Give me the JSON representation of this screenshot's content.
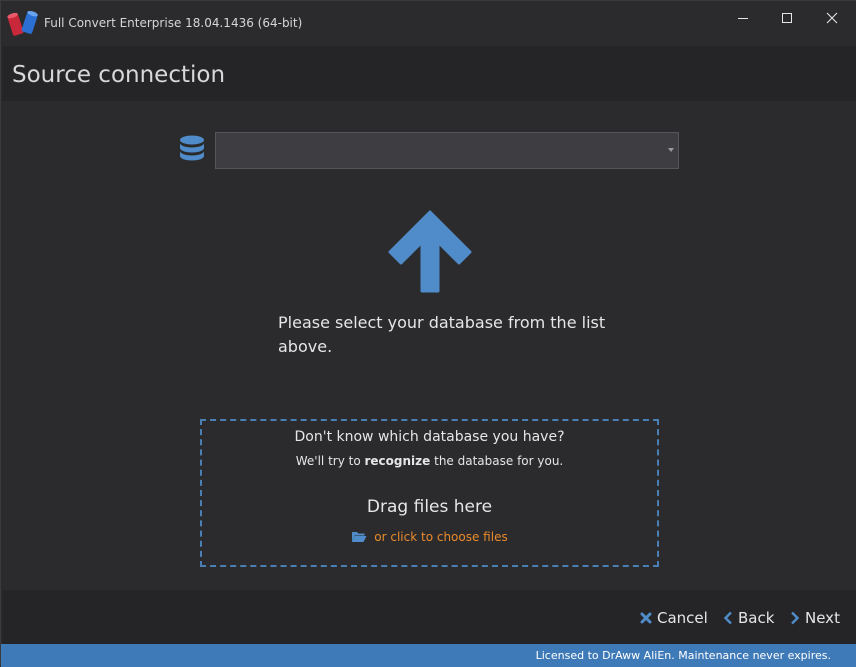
{
  "window": {
    "title": "Full Convert Enterprise 18.04.1436 (64-bit)"
  },
  "header": {
    "title": "Source connection"
  },
  "source": {
    "selected_value": ""
  },
  "main": {
    "instruction": "Please select your database from the list above."
  },
  "dropzone": {
    "question": "Don't know which database you have?",
    "hint_prefix": "We'll try to ",
    "hint_bold": "recognize",
    "hint_suffix": " the database for you.",
    "drag_label": "Drag files here",
    "choose_label": "or click to choose files"
  },
  "footer": {
    "cancel_label": "Cancel",
    "back_label": "Back",
    "next_label": "Next"
  },
  "status": {
    "text": "Licensed to DrAww AliEn. Maintenance never expires."
  },
  "colors": {
    "accent": "#3f7ab8",
    "link_orange": "#e98a2a",
    "background": "#2b2b2e",
    "panel": "#252528"
  },
  "icons": [
    "app-logo-icon",
    "minimize-icon",
    "maximize-icon",
    "close-icon",
    "database-icon",
    "arrow-up-icon",
    "folder-open-icon",
    "cancel-x-icon",
    "chevron-left-icon",
    "chevron-right-icon"
  ]
}
